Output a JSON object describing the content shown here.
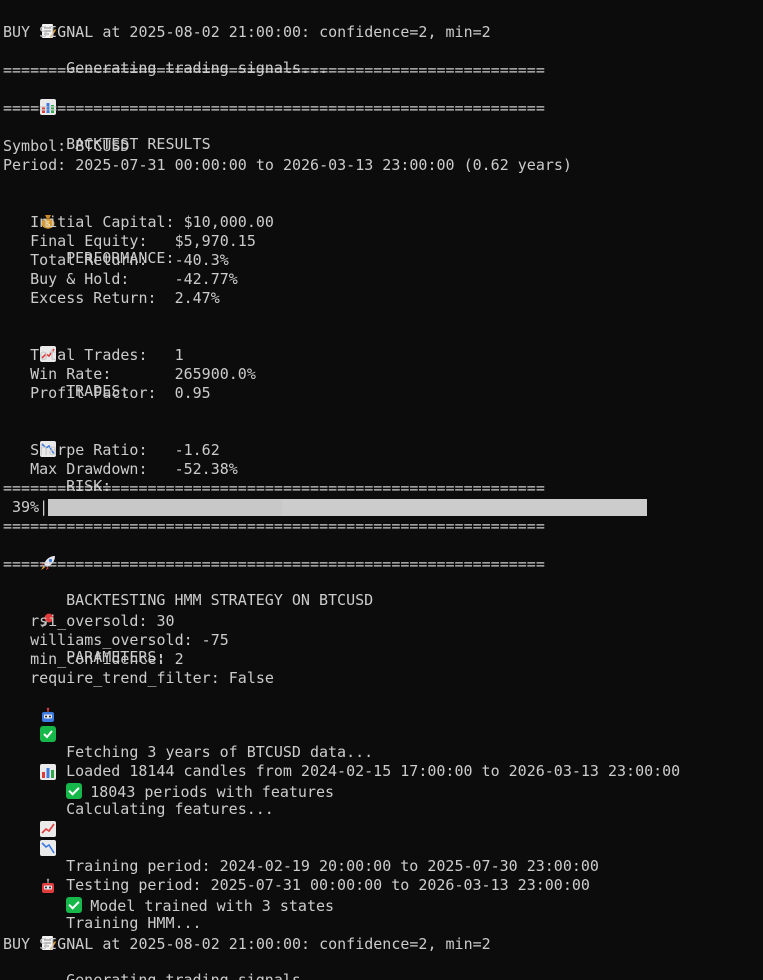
{
  "lines": {
    "l1": "Generating trading signals...",
    "l2": "BUY SIGNAL at 2025-08-02 21:00:00: confidence=2, min=2",
    "sep": "============================================================",
    "backtest_results": "BACKTEST RESULTS",
    "symbol": "Symbol: BTCUSD",
    "period": "Period: 2025-07-31 00:00:00 to 2026-03-13 23:00:00 (0.62 years)",
    "performance": "PERFORMANCE:",
    "initial_capital": "   Initial Capital: $10,000.00",
    "final_equity": "   Final Equity:   $5,970.15",
    "total_return": "   Total Return:   -40.3%",
    "buy_hold": "   Buy & Hold:     -42.77%",
    "excess_return": "   Excess Return:  2.47%",
    "trades": "TRADES:",
    "total_trades": "   Total Trades:   1",
    "win_rate": "   Win Rate:       265900.0%",
    "profit_factor": "   Profit Factor:  0.95",
    "risk": "RISK:",
    "sharpe": "   Sharpe Ratio:   -1.62",
    "drawdown": "   Max Drawdown:   -52.38%",
    "progress_text": " 39%|",
    "backtesting": "BACKTESTING HMM STRATEGY ON BTCUSD",
    "parameters": "PARAMETERS:",
    "p_rsi": "   rsi_oversold: 30",
    "p_williams": "   williams_oversold: -75",
    "p_min_conf": "   min_confidence: 2",
    "p_trend": "   require_trend_filter: False",
    "fetching": "Fetching 3 years of BTCUSD data...",
    "loaded": "Loaded 18144 candles from 2024-02-15 17:00:00 to 2026-03-13 23:00:00",
    "calc_features": "Calculating features...",
    "periods_features": "18043 periods with features",
    "training_period": "Training period: 2024-02-19 20:00:00 to 2025-07-30 23:00:00",
    "testing_period": "Testing period: 2025-07-31 00:00:00 to 2026-03-13 23:00:00",
    "training_hmm": "Training HMM...",
    "model_trained": "Model trained with 3 states",
    "l_end1": "Generating trading signals...",
    "l_end2": "BUY SIGNAL at 2025-08-02 21:00:00: confidence=2, min=2"
  },
  "progress": {
    "value": 0.39
  },
  "icons": {
    "memo": "memo-icon",
    "chart": "bar-chart-icon",
    "money": "money-bag-icon",
    "up": "chart-increasing-icon",
    "down": "chart-decreasing-icon",
    "rocket": "rocket-icon",
    "pin": "pushpin-icon",
    "robot": "robot-icon",
    "check": "check-mark-icon"
  },
  "colors": {
    "background": "#0c0c0c",
    "text": "#cccccc",
    "check_green": "#16b84a"
  }
}
